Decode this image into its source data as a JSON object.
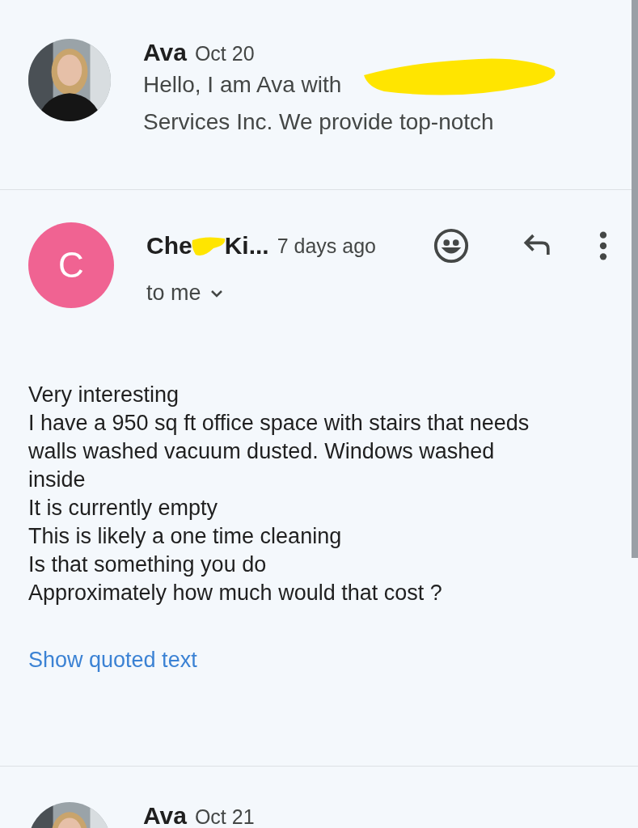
{
  "messages": [
    {
      "kind": "collapsed",
      "avatar": {
        "kind": "picture"
      },
      "sender": "Ava",
      "date": "Oct 20",
      "snippet_lines": [
        "Hello, I am Ava with",
        "Services Inc. We provide top-notch"
      ],
      "redacted": true
    },
    {
      "kind": "expanded",
      "avatar": {
        "kind": "letter",
        "letter": "C",
        "color": "#f06392"
      },
      "sender_parts": [
        "Che",
        "Ki..."
      ],
      "date": "7 days ago",
      "recipient": "to me",
      "body_lines": [
        "Very interesting",
        "I have a 950 sq ft office space  with stairs that needs walls washed vacuum dusted. Windows washed inside",
        "It is currently empty",
        "This is likely a one time cleaning",
        "Is that something you do",
        "Approximately how much would that cost ?"
      ],
      "quoted_link": "Show quoted text"
    },
    {
      "kind": "collapsed",
      "avatar": {
        "kind": "picture"
      },
      "sender": "Ava",
      "date": "Oct 21"
    }
  ]
}
